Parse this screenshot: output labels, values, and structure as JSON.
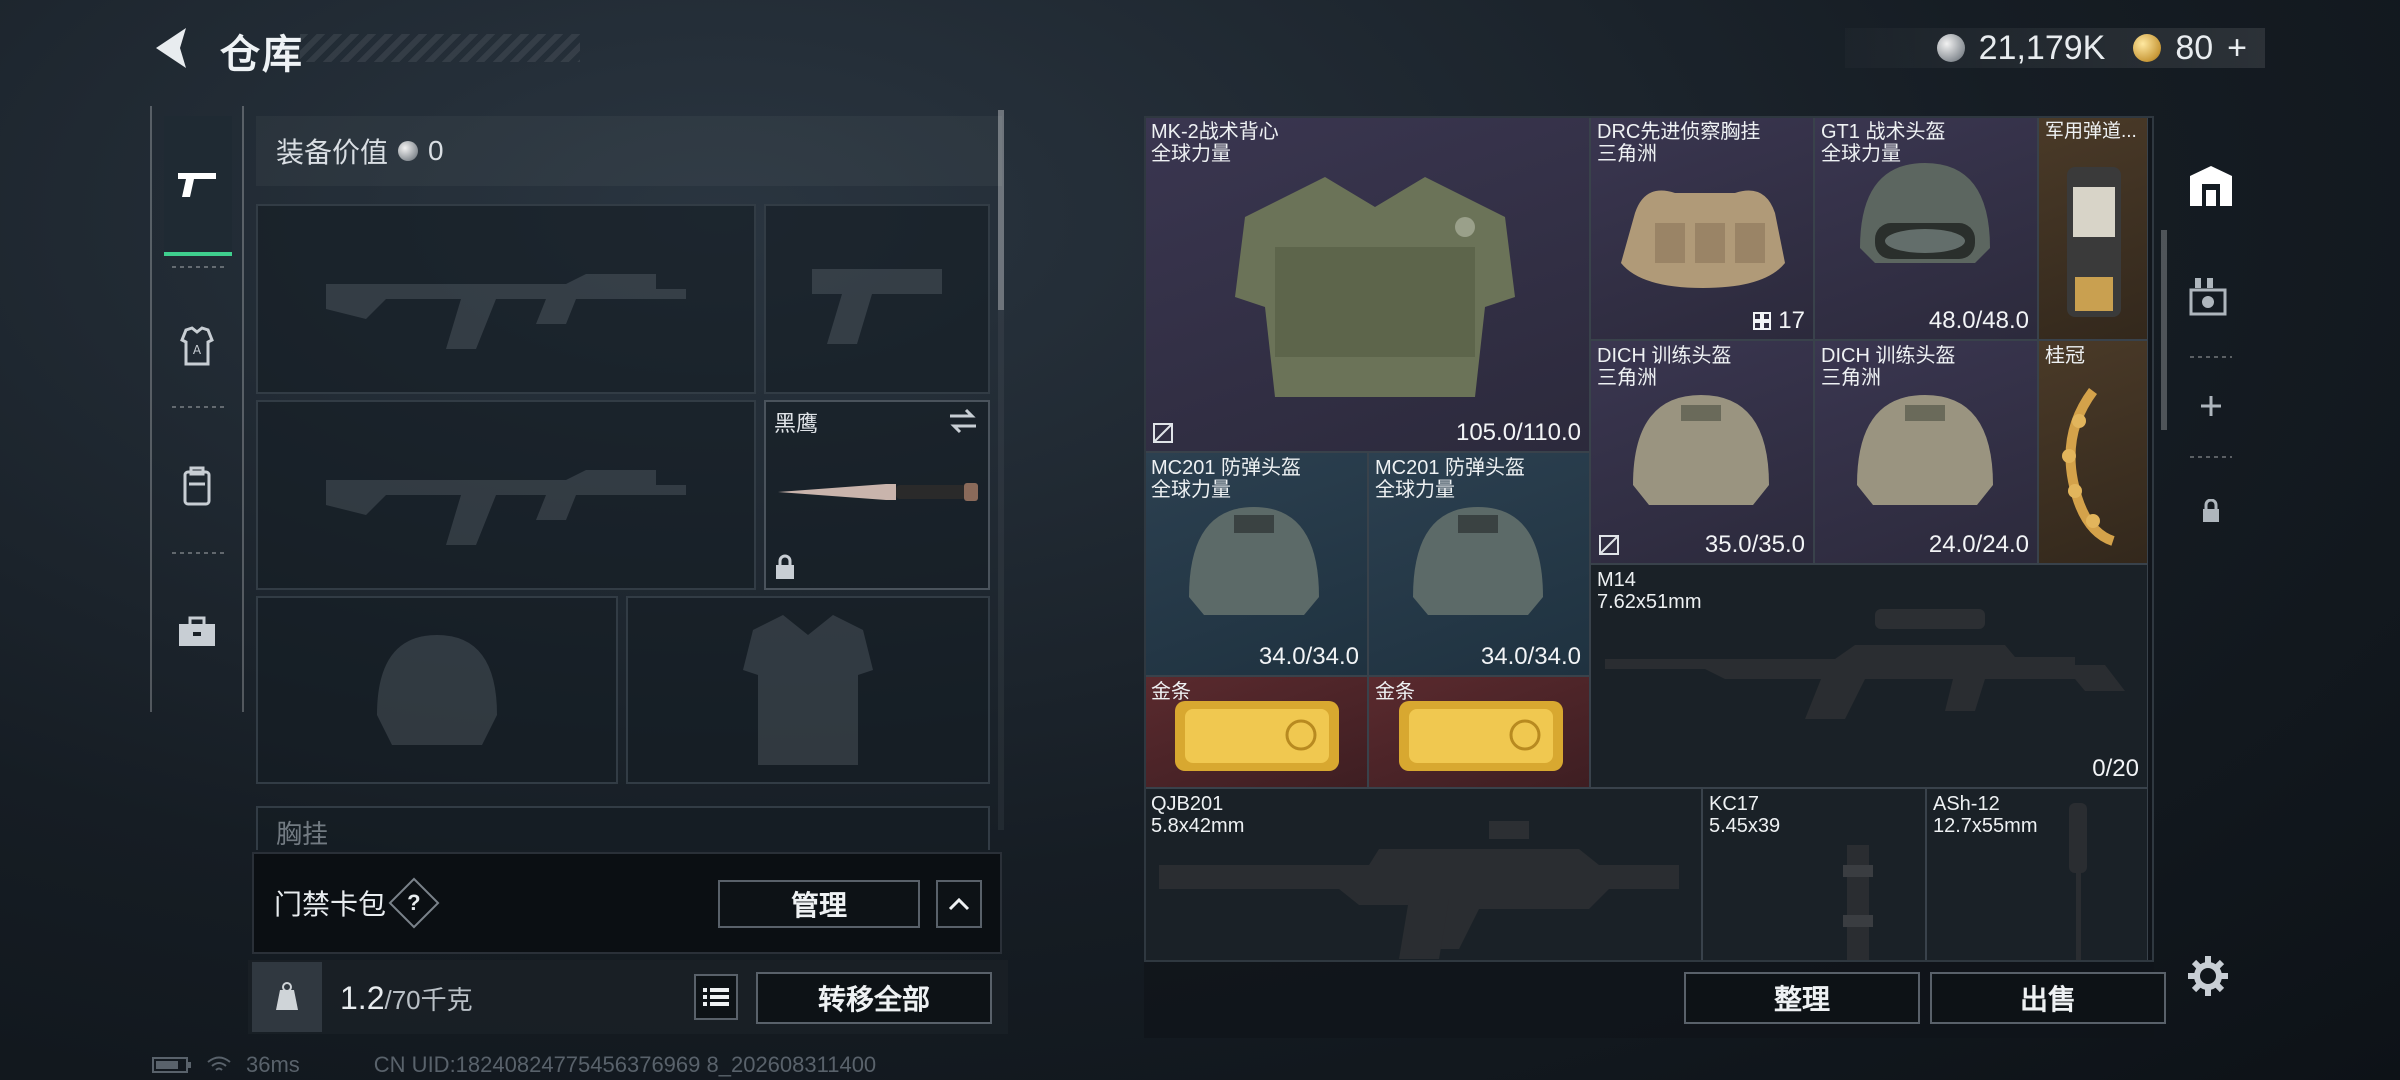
{
  "header": {
    "title": "仓库",
    "currency": {
      "silver_amount": "21,179K",
      "gold_amount": "80",
      "gold_add": "+"
    }
  },
  "equipment": {
    "value_label": "装备价值",
    "value": "0",
    "knife_name": "黑鹰",
    "chest_label": "胸挂",
    "chest_count": "?",
    "card_pack_label": "门禁卡包",
    "card_pack_help": "?",
    "manage_label": "管理",
    "weight_current": "1.2",
    "weight_max": "/70千克",
    "kg_label": "KG",
    "transfer_all_label": "转移全部"
  },
  "status": {
    "ping": "36ms",
    "uid": "CN UID:18240824775456376969 8_202608311400"
  },
  "inventory": {
    "items": [
      {
        "name": "MK-2战术背心",
        "origin": "全球力量",
        "durability": "105.0/110.0",
        "rarity": "purple"
      },
      {
        "name": "DRC先进侦察胸挂",
        "origin": "三角洲",
        "capacity": "17",
        "rarity": "purple"
      },
      {
        "name": "GT1 战术头盔",
        "origin": "全球力量",
        "durability": "48.0/48.0",
        "rarity": "purple"
      },
      {
        "name": "军用弹道...",
        "origin": "",
        "rarity": "gold"
      },
      {
        "name": "DICH 训练头盔",
        "origin": "三角洲",
        "durability": "35.0/35.0",
        "rarity": "purple"
      },
      {
        "name": "DICH 训练头盔",
        "origin": "三角洲",
        "durability": "24.0/24.0",
        "rarity": "purple"
      },
      {
        "name": "桂冠",
        "origin": "",
        "rarity": "gold"
      },
      {
        "name": "MC201 防弹头盔",
        "origin": "全球力量",
        "durability": "34.0/34.0",
        "rarity": "blue"
      },
      {
        "name": "MC201 防弹头盔",
        "origin": "全球力量",
        "durability": "34.0/34.0",
        "rarity": "blue"
      },
      {
        "name": "M14",
        "origin": "7.62x51mm",
        "ammo": "0/20",
        "rarity": "dark"
      },
      {
        "name": "金条",
        "origin": "",
        "rarity": "red"
      },
      {
        "name": "金条",
        "origin": "",
        "rarity": "red"
      },
      {
        "name": "QJB201",
        "origin": "5.8x42mm",
        "rarity": "dark"
      },
      {
        "name": "KC17",
        "origin": "5.45x39",
        "rarity": "dark"
      },
      {
        "name": "ASh-12",
        "origin": "12.7x55mm",
        "rarity": "dark"
      }
    ],
    "sort_label": "整理",
    "sell_label": "出售"
  }
}
